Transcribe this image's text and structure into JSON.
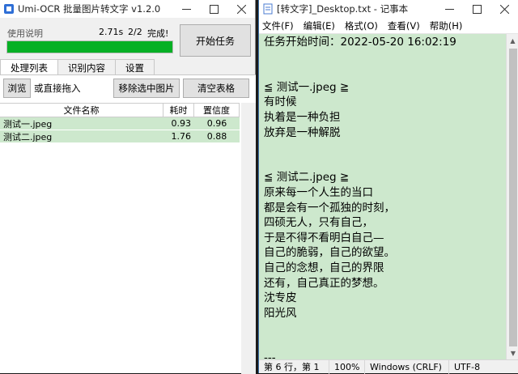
{
  "umi": {
    "title": "Umi-OCR 批量图片转文字 v1.2.0",
    "status": {
      "label": "使用说明",
      "time": "2.71s",
      "count": "2/2",
      "done": "完成!",
      "progress": 1.0
    },
    "start_button": "开始任务",
    "tabs": [
      "处理列表",
      "识别内容",
      "设置"
    ],
    "toolbar": {
      "browse": "浏览",
      "drag_hint": "或直接拖入",
      "remove": "移除选中图片",
      "clear": "清空表格"
    },
    "table": {
      "headers": [
        "文件名称",
        "耗时",
        "置信度"
      ],
      "rows": [
        {
          "name": "测试一.jpeg",
          "time": "0.93",
          "conf": "0.96"
        },
        {
          "name": "测试二.jpeg",
          "time": "1.76",
          "conf": "0.88"
        }
      ]
    },
    "accent_color": "#06b025",
    "row_highlight": "#cde8cd"
  },
  "notepad": {
    "title": "[转文字]_Desktop.txt - 记事本",
    "menu": [
      "文件(F)",
      "编辑(E)",
      "格式(O)",
      "查看(V)",
      "帮助(H)"
    ],
    "lines": [
      "任务开始时间：2022-05-20 16:02:19",
      "",
      "",
      "≦ 测试一.jpeg ≧",
      "有时候",
      "执着是一种负担",
      "放弃是一种解脱",
      "",
      "",
      "≦ 测试二.jpeg ≧",
      "原来每一个人生的当口",
      "都是会有一个孤独的时刻，",
      "四硕无人，只有自己，",
      "于是不得不看明白自己—",
      "自己的脆弱，自己的欲望。",
      "自己的念想，自己的界限",
      "还有，自己真正的梦想。",
      "沈专皮",
      "阳光风",
      "",
      "",
      "---"
    ],
    "statusbar": {
      "position": "第 6 行，第 1",
      "zoom": "100%",
      "line_ending": "Windows (CRLF)",
      "encoding": "UTF-8"
    },
    "background": "#cde8cd"
  }
}
